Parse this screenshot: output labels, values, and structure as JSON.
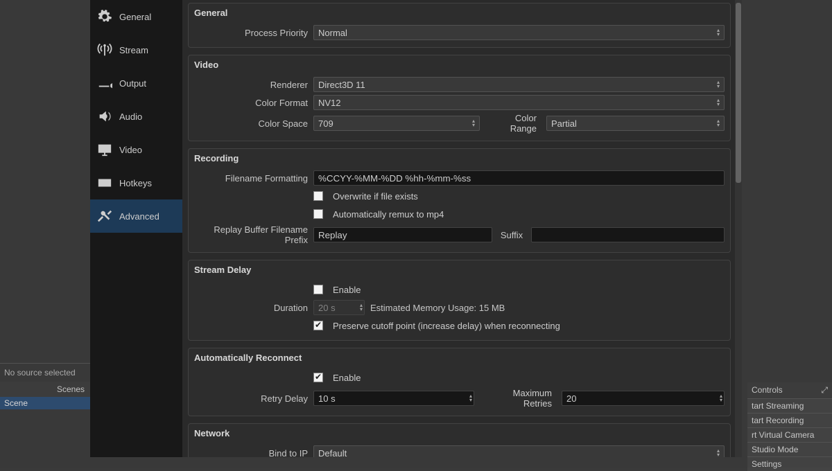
{
  "sidebar": {
    "items": [
      {
        "label": "General"
      },
      {
        "label": "Stream"
      },
      {
        "label": "Output"
      },
      {
        "label": "Audio"
      },
      {
        "label": "Video"
      },
      {
        "label": "Hotkeys"
      },
      {
        "label": "Advanced"
      }
    ]
  },
  "general": {
    "title": "General",
    "process_priority_label": "Process Priority",
    "process_priority": "Normal"
  },
  "video": {
    "title": "Video",
    "renderer_label": "Renderer",
    "renderer": "Direct3D 11",
    "color_format_label": "Color Format",
    "color_format": "NV12",
    "color_space_label": "Color Space",
    "color_space": "709",
    "color_range_label": "Color Range",
    "color_range": "Partial"
  },
  "recording": {
    "title": "Recording",
    "filename_formatting_label": "Filename Formatting",
    "filename_formatting": "%CCYY-%MM-%DD %hh-%mm-%ss",
    "overwrite_label": "Overwrite if file exists",
    "remux_label": "Automatically remux to mp4",
    "replay_prefix_label": "Replay Buffer Filename Prefix",
    "replay_prefix": "Replay",
    "suffix_label": "Suffix",
    "suffix": ""
  },
  "stream_delay": {
    "title": "Stream Delay",
    "enable_label": "Enable",
    "duration_label": "Duration",
    "duration": "20 s",
    "est_label": "Estimated Memory Usage: 15 MB",
    "preserve_label": "Preserve cutoff point (increase delay) when reconnecting"
  },
  "reconnect": {
    "title": "Automatically Reconnect",
    "enable_label": "Enable",
    "retry_delay_label": "Retry Delay",
    "retry_delay": "10 s",
    "max_retries_label": "Maximum Retries",
    "max_retries": "20"
  },
  "network": {
    "title": "Network",
    "bind_label": "Bind to IP",
    "bind": "Default"
  },
  "bg": {
    "no_source": "No source selected",
    "scenes_header": "Scenes",
    "scene_item": "Scene",
    "controls_header": "Controls",
    "start_streaming": "tart Streaming",
    "start_recording": "tart Recording",
    "virtual_camera": "rt Virtual Camera",
    "studio_mode": "Studio Mode",
    "settings": "Settings"
  }
}
